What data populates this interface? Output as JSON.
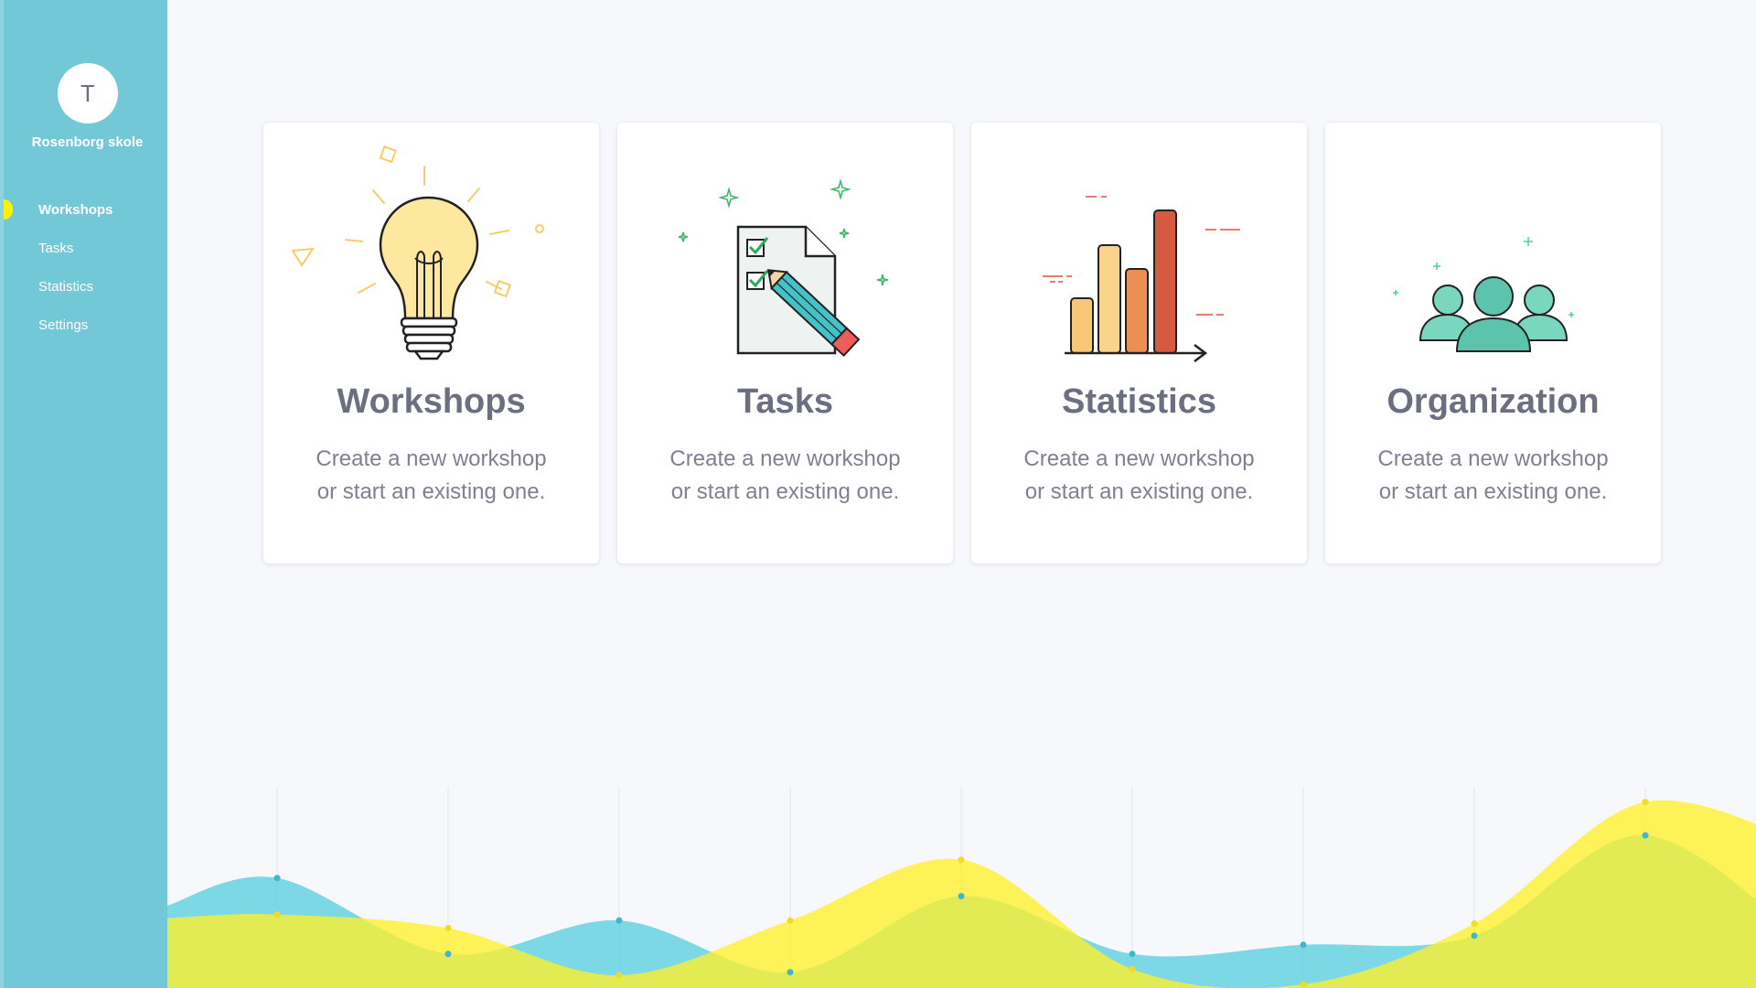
{
  "sidebar": {
    "avatar_initial": "T",
    "school_name": "Rosenborg skole",
    "items": [
      {
        "label": "Workshops",
        "active": true
      },
      {
        "label": "Tasks",
        "active": false
      },
      {
        "label": "Statistics",
        "active": false
      },
      {
        "label": "Settings",
        "active": false
      }
    ],
    "colors": {
      "background": "#73c8d8",
      "active_marker": "#fff200"
    }
  },
  "cards": [
    {
      "title": "Workshops",
      "line1": "Create a new workshop",
      "line2": "or start an existing one.",
      "icon": "lightbulb-icon"
    },
    {
      "title": "Tasks",
      "line1": "Create a new workshop",
      "line2": "or start an existing one.",
      "icon": "checklist-pencil-icon"
    },
    {
      "title": "Statistics",
      "line1": "Create a new workshop",
      "line2": "or start an existing one.",
      "icon": "bar-chart-icon"
    },
    {
      "title": "Organization",
      "line1": "Create a new workshop",
      "line2": "or start an existing one.",
      "icon": "people-icon"
    }
  ],
  "chart_data": {
    "type": "area",
    "x": [
      0,
      1,
      2,
      3,
      4,
      5,
      6,
      7,
      8,
      9
    ],
    "series": [
      {
        "values": [
          70,
          20,
          42,
          8,
          58,
          20,
          26,
          32,
          98,
          15
        ],
        "color": "#5ccfe0"
      },
      {
        "values": [
          46,
          37,
          6,
          42,
          82,
          10,
          0,
          40,
          120,
          85
        ],
        "color": "#fff02a"
      }
    ],
    "ylim": [
      0,
      130
    ],
    "grid": true
  }
}
